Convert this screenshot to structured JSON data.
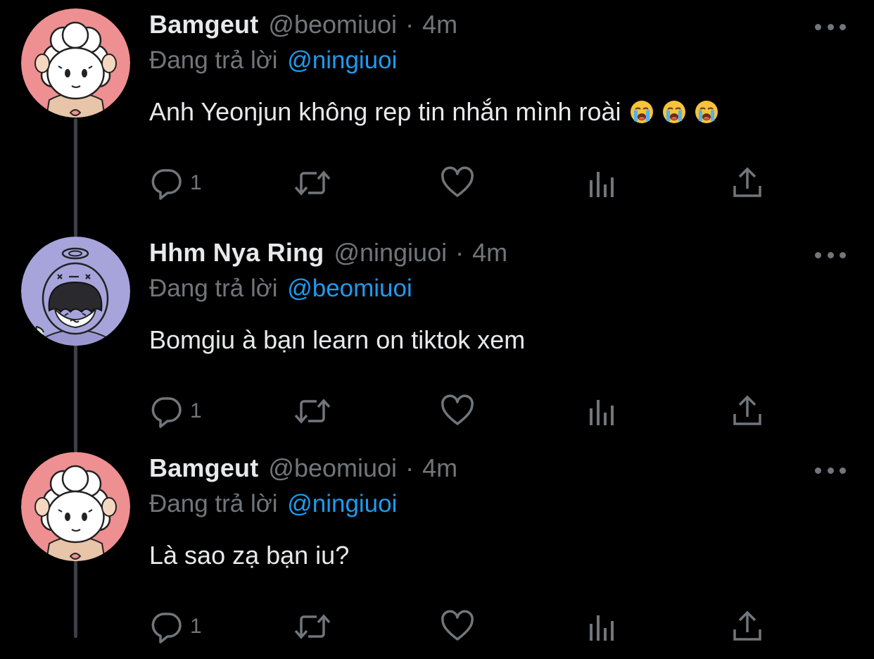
{
  "thread": {
    "tweets": [
      {
        "display_name": "Bamgeut",
        "handle": "@beomiuoi",
        "separator": "·",
        "time": "4m",
        "replying_prefix": "Đang trả lời",
        "replying_to": "@ningiuoi",
        "text": "Anh Yeonjun không rep tin nhắn mình roài",
        "emojis": [
          "loudly-crying-face",
          "loudly-crying-face",
          "loudly-crying-face"
        ],
        "reply_count": "1",
        "avatar": "pink-lamb-avatar"
      },
      {
        "display_name": "Hhm Nya Ring",
        "handle": "@ningiuoi",
        "separator": "·",
        "time": "4m",
        "replying_prefix": "Đang trả lời",
        "replying_to": "@beomiuoi",
        "text": "Bomgiu à bạn learn on tiktok xem",
        "emojis": [],
        "reply_count": "1",
        "avatar": "purple-angel-avatar"
      },
      {
        "display_name": "Bamgeut",
        "handle": "@beomiuoi",
        "separator": "·",
        "time": "4m",
        "replying_prefix": "Đang trả lời",
        "replying_to": "@ningiuoi",
        "text": "Là sao zạ bạn iu?",
        "emojis": [],
        "reply_count": "1",
        "avatar": "pink-lamb-avatar"
      }
    ]
  },
  "colors": {
    "background": "#000000",
    "text_primary": "#e7e9ea",
    "text_secondary": "#71767b",
    "accent": "#1d9bf0",
    "thread_line": "#3b4047",
    "avatar_pink": "#ee8f92",
    "avatar_purple": "#a7a4dc"
  },
  "icons": [
    "reply-icon",
    "retweet-icon",
    "like-icon",
    "analytics-icon",
    "share-icon",
    "more-icon"
  ]
}
